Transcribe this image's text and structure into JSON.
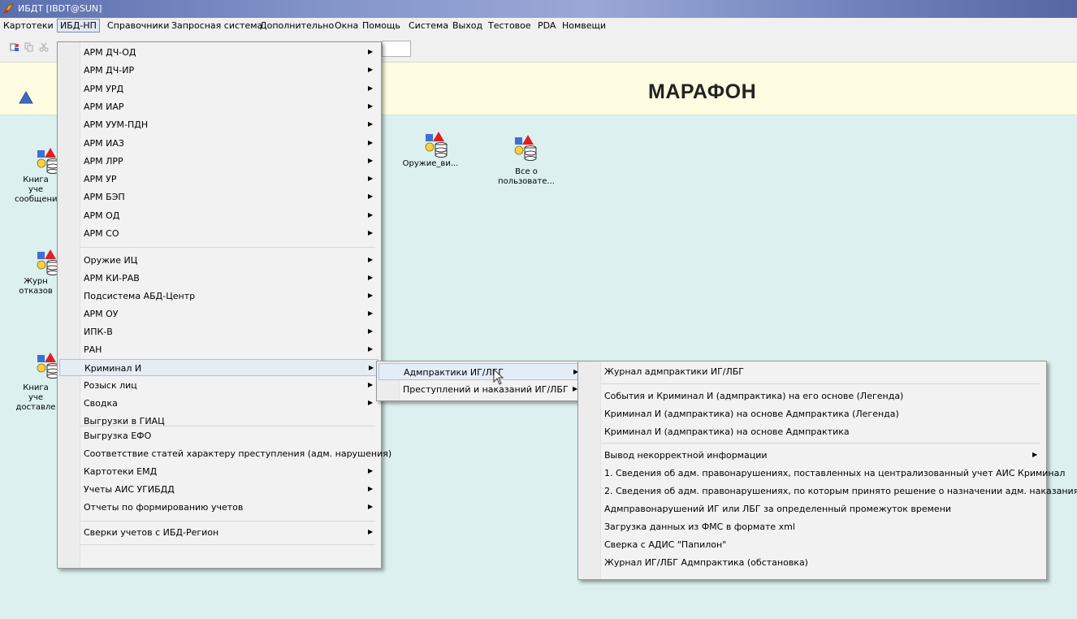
{
  "window": {
    "title": "ИБДТ [IBDT@SUN]"
  },
  "menubar": [
    "Картотеки",
    "ИБД-НП",
    "Справочники",
    "Запросная система",
    "Дополнительно",
    "Окна",
    "Помощь",
    "Система",
    "Выход",
    "Тестовое",
    "PDA",
    "Номвещи"
  ],
  "banner": {
    "title": "МАРАФОН"
  },
  "desktop": {
    "icons": [
      {
        "name": "desktop-icon-book-messages",
        "label": "Книга уче\nсообщени"
      },
      {
        "name": "desktop-icon-journal-refusals",
        "label": "Журн\nотказов"
      },
      {
        "name": "desktop-icon-book-delivered",
        "label": "Книга уче\nдоставле"
      },
      {
        "name": "desktop-icon-weapons",
        "label": "Оружие_ви..."
      },
      {
        "name": "desktop-icon-all-about-user",
        "label": "Все о\nпользовате..."
      }
    ]
  },
  "menu_ibd_np": [
    {
      "label": "АРМ ДЧ-ОД",
      "sub": true
    },
    {
      "label": "АРМ ДЧ-ИР",
      "sub": true
    },
    {
      "label": "АРМ УРД",
      "sub": true
    },
    {
      "label": "АРМ ИАР",
      "sub": true
    },
    {
      "label": "АРМ УУМ-ПДН",
      "sub": true
    },
    {
      "label": "АРМ ИАЗ",
      "sub": true
    },
    {
      "label": "АРМ ЛРР",
      "sub": true
    },
    {
      "label": "АРМ УР",
      "sub": true
    },
    {
      "label": "АРМ БЭП",
      "sub": true
    },
    {
      "label": "АРМ ОД",
      "sub": true
    },
    {
      "label": "АРМ СО",
      "sub": true
    },
    {
      "label": "Оружие ИЦ",
      "sub": true
    },
    {
      "label": "АРМ КИ-РАВ",
      "sub": true
    },
    {
      "label": "Подсистема АБД-Центр",
      "sub": true
    },
    {
      "label": "АРМ ОУ",
      "sub": true
    },
    {
      "label": "ИПК-В",
      "sub": true
    },
    {
      "label": "РАН",
      "sub": true
    },
    {
      "label": "Криминал И",
      "sub": true,
      "highlighted": true
    },
    {
      "label": "Розыск лиц",
      "sub": true
    },
    {
      "label": "Сводка",
      "sub": true
    },
    {
      "label": "Выгрузки в ГИАЦ",
      "sub": false
    },
    {
      "label": "Выгрузка ЕФО",
      "sub": false
    },
    {
      "label": "Соответствие статей характеру преступления (адм. нарушения)",
      "sub": false
    },
    {
      "label": "Картотеки ЕМД",
      "sub": true
    },
    {
      "label": "Учеты АИС УГИБДД",
      "sub": true
    },
    {
      "label": "Отчеты по формированию учетов",
      "sub": true
    },
    {
      "label": "Сверки учетов с ИБД-Регион",
      "sub": true
    }
  ],
  "menu_kriminal": [
    {
      "label": "Адмпрактики ИГ/ЛБГ",
      "sub": true,
      "highlighted": true
    },
    {
      "label": "Преступлений и наказаний ИГ/ЛБГ",
      "sub": true
    }
  ],
  "menu_admpraktiki": [
    {
      "label": "Журнал адмпрактики ИГ/ЛБГ",
      "sub": false
    },
    {
      "label": "События и Криминал И (адмпрактика) на его основе (Легенда)",
      "sub": false
    },
    {
      "label": "Криминал И (адмпрактика) на основе Адмпрактика (Легенда)",
      "sub": false
    },
    {
      "label": "Криминал И (адмпрактика) на основе Адмпрактика",
      "sub": false
    },
    {
      "label": "Вывод некорректной информации",
      "sub": true
    },
    {
      "label": "1. Сведения об адм. правонарушениях, поставленных на централизованный учет АИС Криминал",
      "sub": false
    },
    {
      "label": "2. Сведения об адм. правонарушениях, по которым принято решение о назначении адм. наказания",
      "sub": false
    },
    {
      "label": "Адмправонарушений ИГ или ЛБГ за определенный промежуток времени",
      "sub": false
    },
    {
      "label": "Загрузка данных из ФМС в формате xml",
      "sub": false
    },
    {
      "label": "Сверка с АДИС \"Папилон\"",
      "sub": false
    },
    {
      "label": "Журнал ИГ/ЛБГ Адмпрактика (обстановка)",
      "sub": false
    }
  ]
}
